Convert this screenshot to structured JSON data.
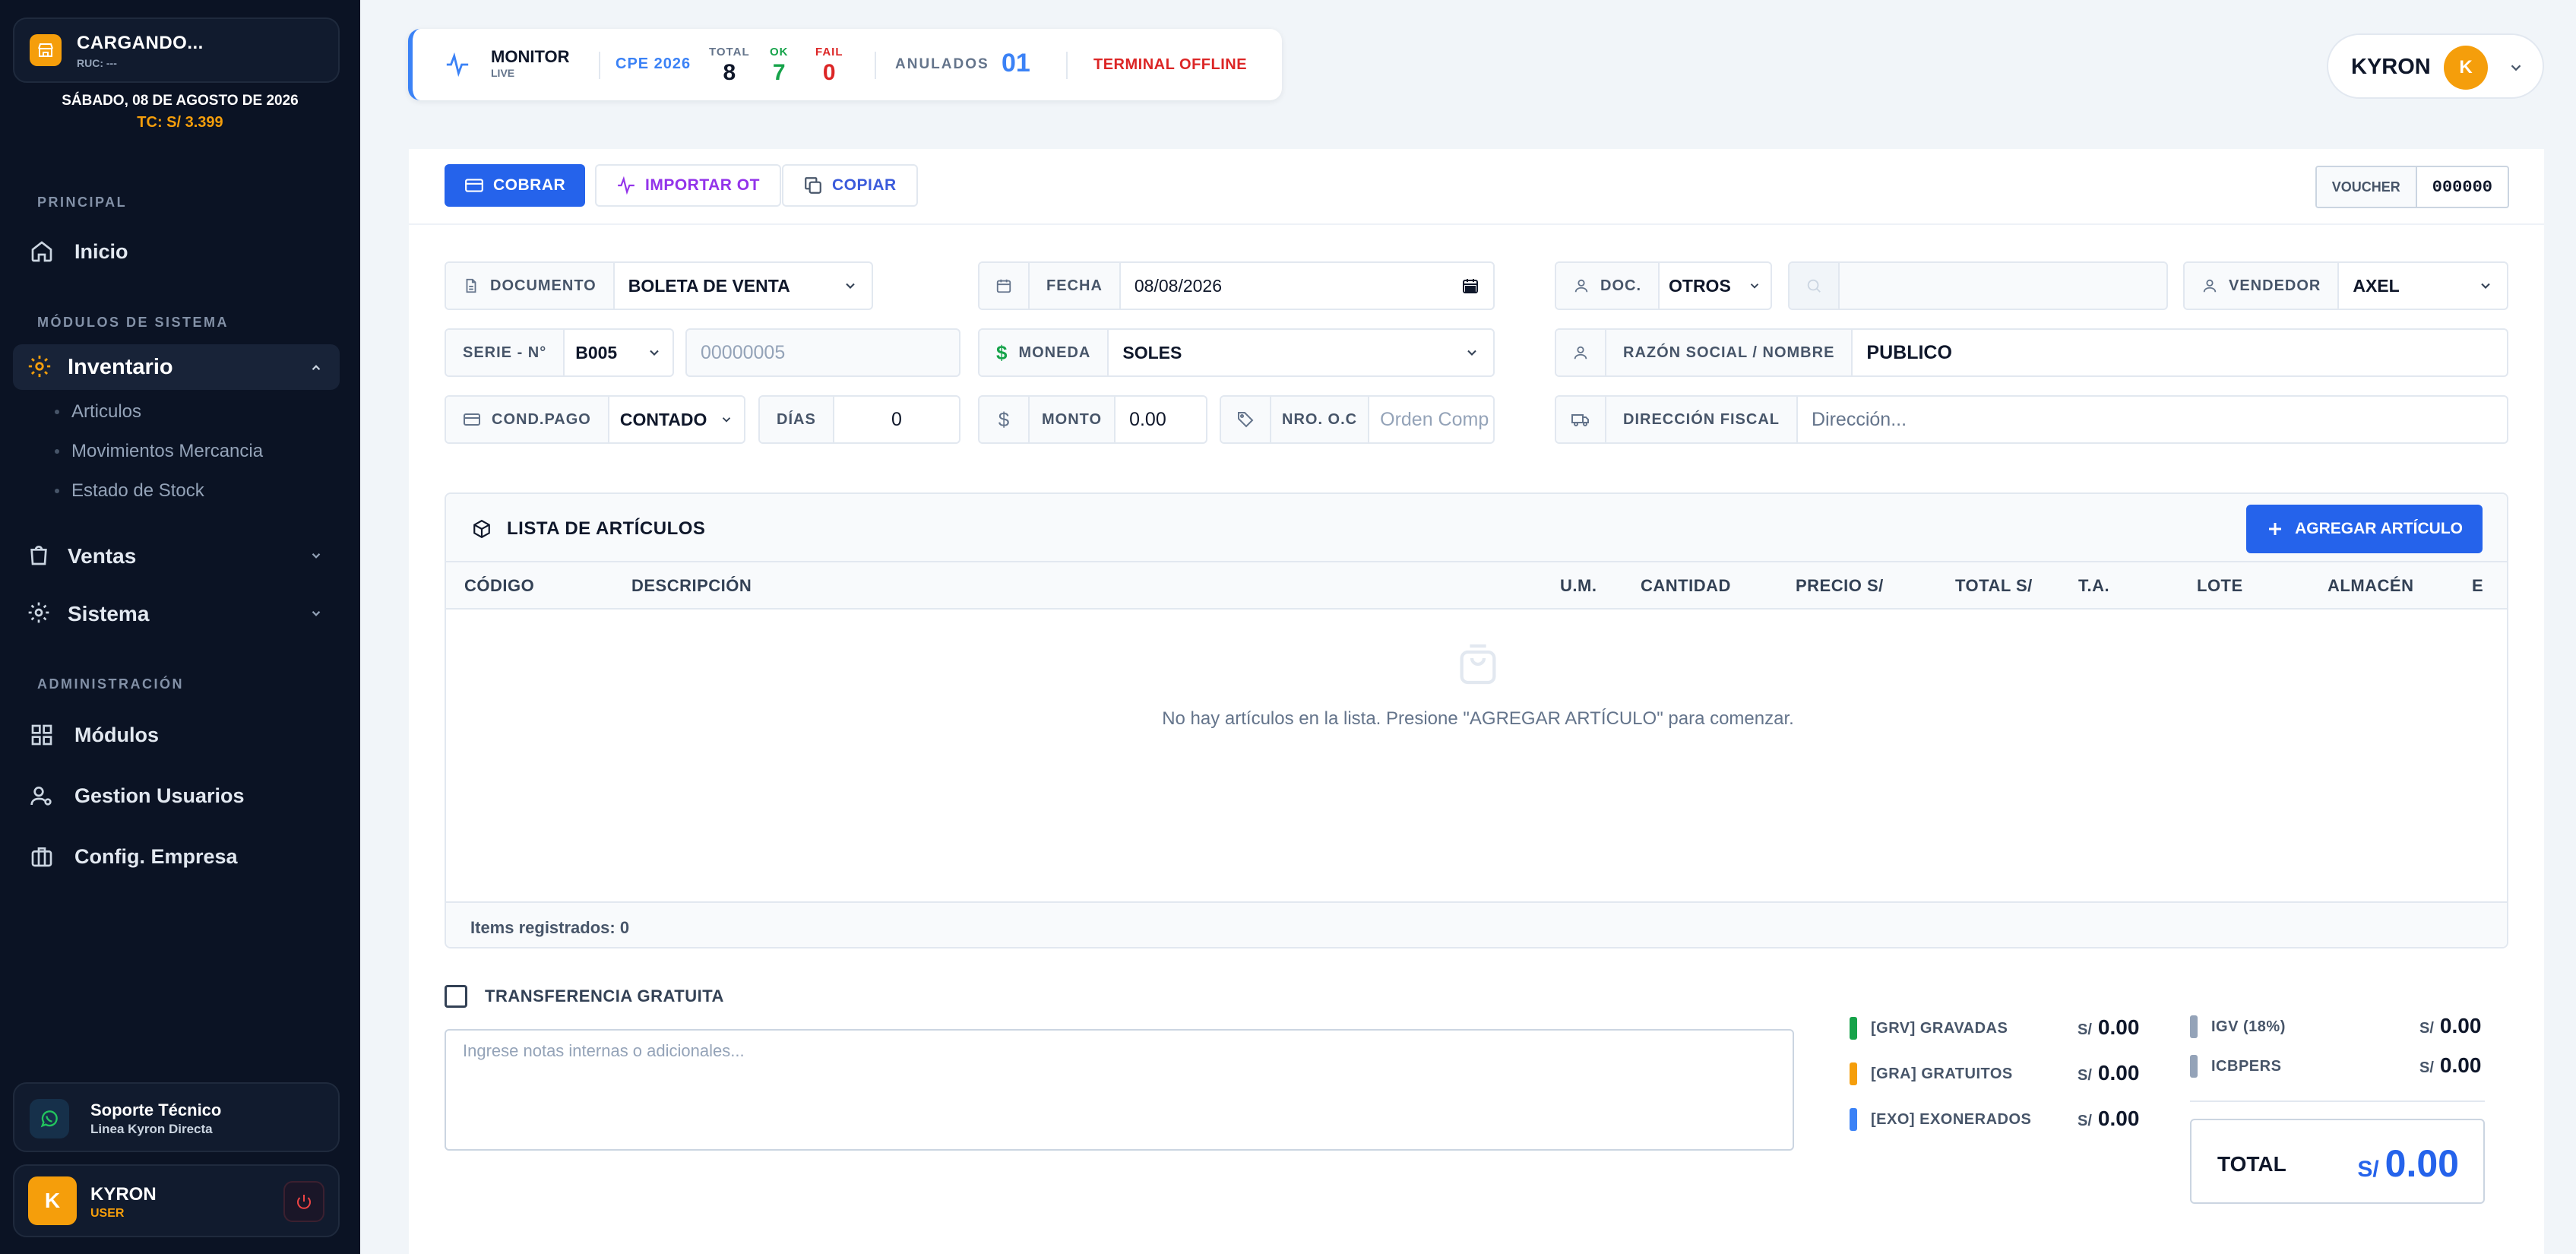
{
  "sidebar": {
    "brand_title": "CARGANDO...",
    "brand_sub": "RUC: ---",
    "date": "SÁBADO, 08 DE AGOSTO DE 2026",
    "tc": "TC: S/ 3.399",
    "sections": [
      "PRINCIPAL",
      "MÓDULOS DE SISTEMA",
      "ADMINISTRACIÓN"
    ],
    "inicio": "Inicio",
    "inventario": "Inventario",
    "inventario_items": [
      "Articulos",
      "Movimientos Mercancia",
      "Estado de Stock"
    ],
    "ventas": "Ventas",
    "sistema": "Sistema",
    "admin_items": [
      "Módulos",
      "Gestion Usuarios",
      "Config. Empresa"
    ],
    "support_title": "Soporte Técnico",
    "support_sub": "Linea Kyron Directa",
    "user_initial": "K",
    "user_name": "KYRON",
    "user_role": "USER"
  },
  "monitor": {
    "title": "MONITOR",
    "sub": "LIVE",
    "cpe": "CPE 2026",
    "total_label": "TOTAL",
    "total": "8",
    "ok_label": "OK",
    "ok": "7",
    "fail_label": "FAIL",
    "fail": "0",
    "anulados_label": "ANULADOS",
    "anulados": "01",
    "status": "TERMINAL OFFLINE"
  },
  "topuser": {
    "name": "KYRON",
    "initial": "K"
  },
  "toolbar": {
    "cobrar": "COBRAR",
    "importar": "IMPORTAR OT",
    "copiar": "COPIAR",
    "voucher_label": "VOUCHER",
    "voucher_value": "000000"
  },
  "form": {
    "documento_label": "DOCUMENTO",
    "documento_value": "BOLETA DE VENTA",
    "fecha_label": "FECHA",
    "fecha_value": "08/08/2026",
    "doc_label": "DOC.",
    "doc_value": "OTROS",
    "doc_number_placeholder": "",
    "vendedor_label": "VENDEDOR",
    "vendedor_value": "AXEL",
    "serie_label": "SERIE - N°",
    "serie_value": "B005",
    "numero_placeholder": "00000005",
    "moneda_label": "MONEDA",
    "moneda_value": "SOLES",
    "razon_label": "RAZÓN SOCIAL / NOMBRE",
    "razon_value": "PUBLICO",
    "cond_label": "COND.PAGO",
    "cond_value": "CONTADO",
    "dias_label": "DÍAS",
    "dias_value": "0",
    "monto_label": "MONTO",
    "monto_value": "0.00",
    "nro_oc_label": "NRO. O.C",
    "nro_oc_placeholder": "Orden Comp",
    "direccion_label": "DIRECCIÓN FISCAL",
    "direccion_placeholder": "Dirección..."
  },
  "list": {
    "title": "LISTA DE ARTÍCULOS",
    "add_button": "AGREGAR ARTÍCULO",
    "columns": [
      "CÓDIGO",
      "DESCRIPCIÓN",
      "U.M.",
      "CANTIDAD",
      "PRECIO S/",
      "TOTAL S/",
      "T.A.",
      "LOTE",
      "ALMACÉN",
      "E"
    ],
    "empty_message": "No hay artículos en la lista. Presione \"AGREGAR ARTÍCULO\" para comenzar.",
    "footer": "Items registrados: 0"
  },
  "bottom": {
    "transfer_label": "TRANSFERENCIA GRATUITA",
    "notes_placeholder": "Ingrese notas internas o adicionales...",
    "currency": "S/",
    "gravadas_label": "[GRV] GRAVADAS",
    "gravadas": "0.00",
    "gratuitos_label": "[GRA] GRATUITOS",
    "gratuitos": "0.00",
    "exonerados_label": "[EXO] EXONERADOS",
    "exonerados": "0.00",
    "igv_label": "IGV (18%)",
    "igv": "0.00",
    "icbpers_label": "ICBPERS",
    "icbpers": "0.00",
    "total_label": "TOTAL",
    "total": "0.00"
  },
  "colors": {
    "accent": "#2563eb",
    "sidebar": "#0b1324",
    "warning": "#f59e0b",
    "danger": "#dc2626",
    "success": "#16a34a"
  }
}
